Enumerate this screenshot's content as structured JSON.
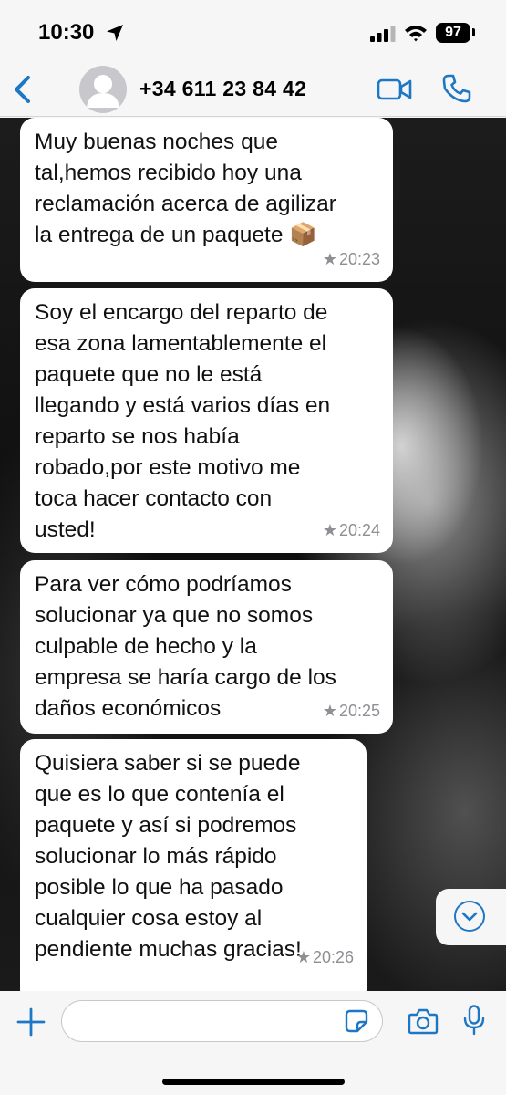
{
  "status_bar": {
    "time": "10:30",
    "battery": "97",
    "icons": [
      "location-arrow-icon",
      "cellular-signal-icon",
      "wifi-icon",
      "battery-icon"
    ]
  },
  "header": {
    "contact": "+34 611 23 84 42",
    "icons": [
      "back-chevron-icon",
      "avatar-placeholder-icon",
      "video-call-icon",
      "phone-call-icon"
    ]
  },
  "messages": [
    {
      "text": "Muy buenas noches que\ntal,hemos recibido hoy una\nreclamación acerca de agilizar\nla entrega de un paquete 📦",
      "time": "20:23",
      "starred": true
    },
    {
      "text": "Soy el encargo del reparto de\nesa zona lamentablemente el\npaquete que no le está\nllegando y está varios días en\nreparto se nos había\nrobado,por este motivo me\ntoca hacer contacto con\nusted!",
      "time": "20:24",
      "starred": true
    },
    {
      "text": "Para ver cómo podríamos\nsolucionar ya que no somos\nculpable de hecho y la\nempresa se haría cargo de los\ndaños económicos",
      "time": "20:25",
      "starred": true
    },
    {
      "text": "Quisiera saber si se puede\nque es lo que contenía el\npaquete y así si podremos\nsolucionar lo más rápido\nposible lo que ha pasado\ncualquier cosa estoy al\npendiente muchas gracias!",
      "time": "20:26",
      "starred": true
    }
  ],
  "star_glyph": "★",
  "input_bar": {
    "placeholder": "",
    "icons": [
      "plus-icon",
      "sticker-icon",
      "camera-icon",
      "microphone-icon"
    ]
  },
  "colors": {
    "accent": "#1d77c5",
    "bubble": "#ffffff",
    "bar_background": "#f6f6f6",
    "meta_text": "#8e8e93"
  }
}
